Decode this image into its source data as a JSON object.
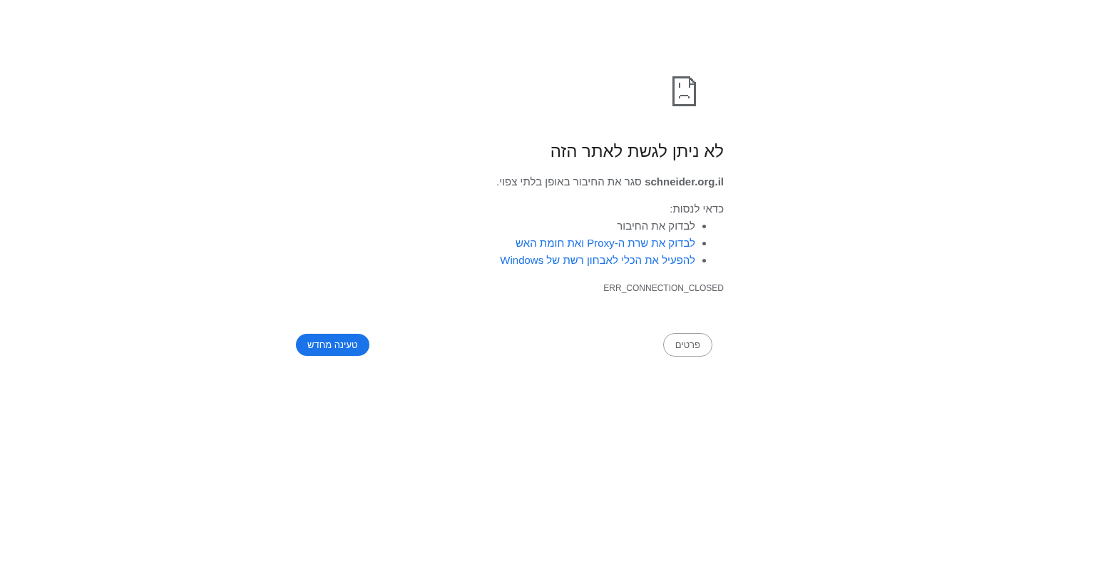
{
  "error_page": {
    "title": "לא ניתן לגשת לאתר הזה",
    "message": "**schneider.org.il** סגר את החיבור באופן בלתי צפוי.",
    "suggestions_heading": "כדאי לנסות:",
    "suggestions": [
      {
        "kind": "text",
        "text": "לבדוק את החיבור"
      },
      {
        "kind": "link",
        "text": "לבדוק את שרת ה-Proxy ואת חומת האש"
      },
      {
        "kind": "link",
        "text": "להפעיל את הכלי לאבחון רשת של Windows"
      }
    ],
    "error_code": "ERR_CONNECTION_CLOSED"
  },
  "buttons": [
    {
      "kind": "secondary",
      "label": "פרטים"
    },
    {
      "kind": "primary",
      "label": "טעינה מחדש"
    }
  ]
}
